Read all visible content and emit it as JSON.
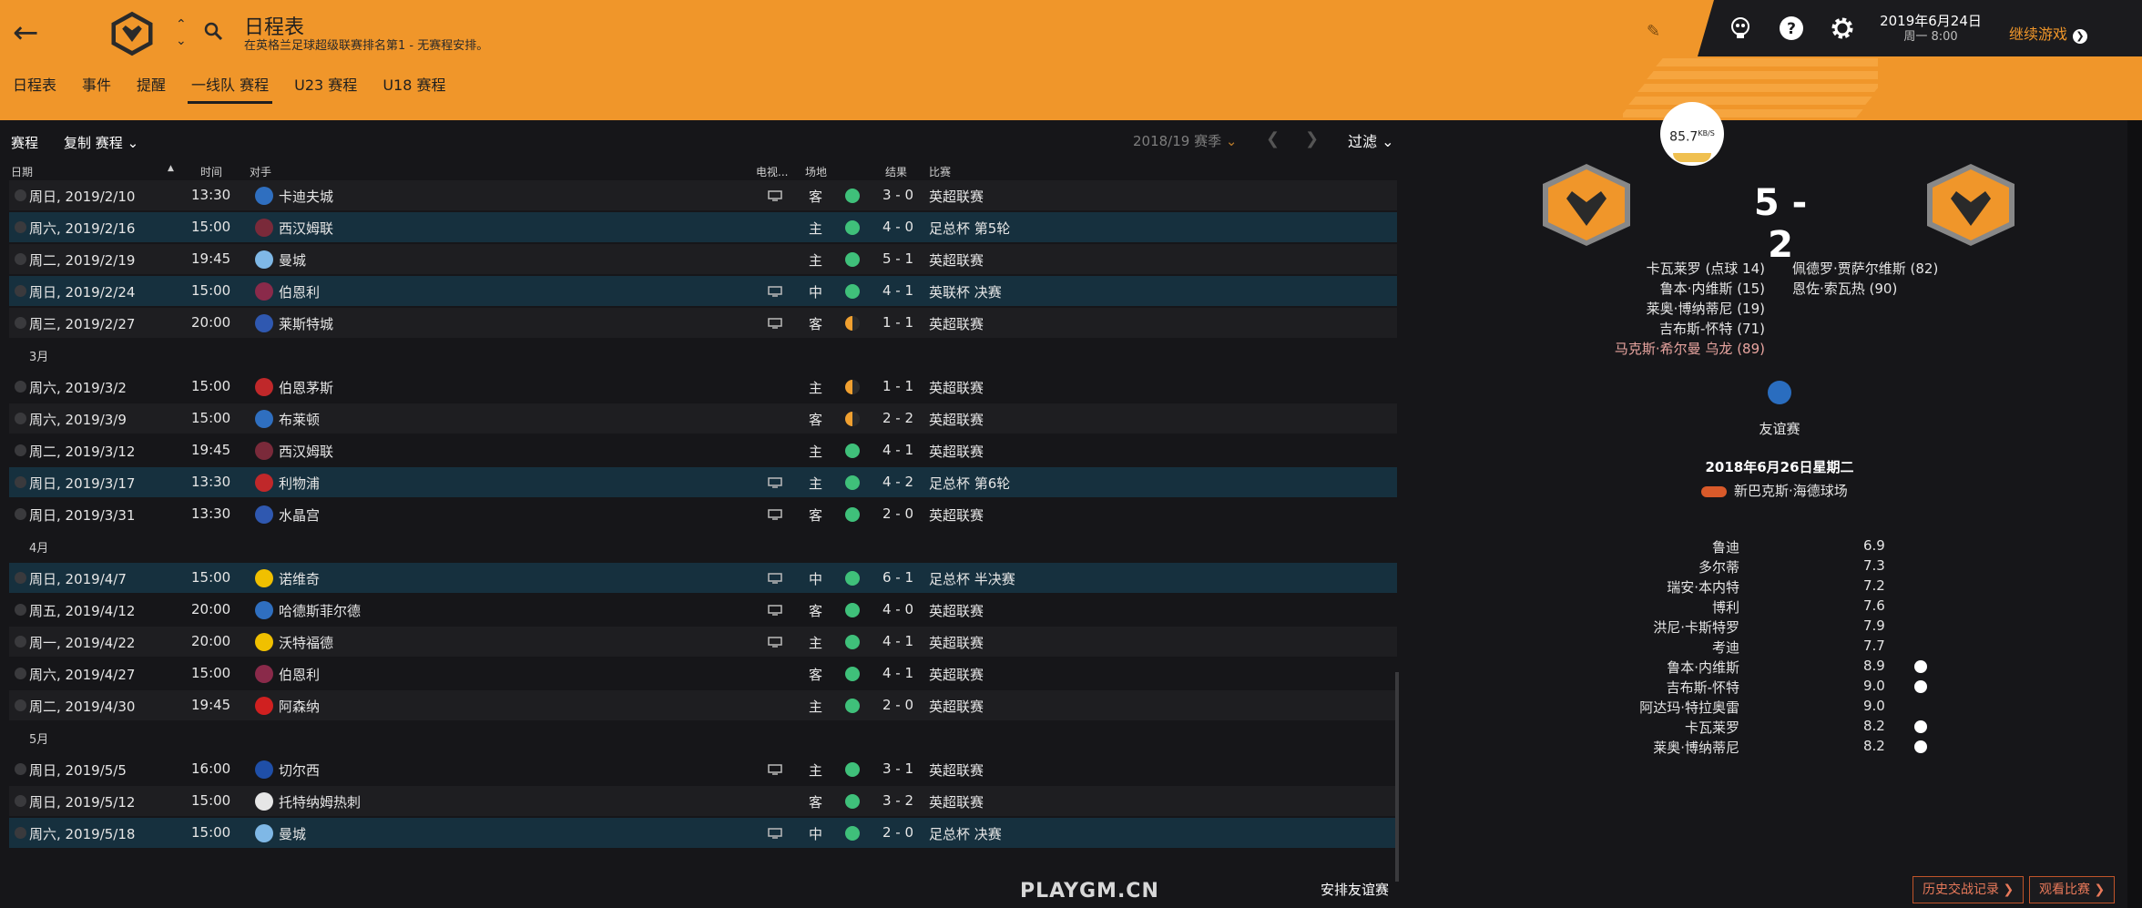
{
  "header": {
    "title": "日程表",
    "subtitle": "在英格兰足球超级联赛排名第1 - 无赛程安排。",
    "tabs": [
      "日程表",
      "事件",
      "提醒",
      "一线队 赛程",
      "U23 赛程",
      "U18 赛程"
    ],
    "active_tab_index": 3
  },
  "top_right": {
    "date": "2019年6月24日",
    "time": "周一 8:00",
    "continue_label": "继续游戏",
    "icons": [
      "fm-icon",
      "help-icon",
      "settings-icon"
    ]
  },
  "panel": {
    "label": "赛程",
    "dropdown": "复制 赛程",
    "season": "2018/19 赛季",
    "filter": "过滤",
    "columns": [
      "日期",
      "时间",
      "对手",
      "电视...",
      "场地",
      "结果",
      "比赛"
    ],
    "arrange_label": "安排友谊赛",
    "watermark": "PLAYGM.CN"
  },
  "fixtures": [
    {
      "date": "周日, 2019/2/10",
      "time": "13:30",
      "opp": "卡迪夫城",
      "tv": true,
      "venue": "客",
      "res": "win",
      "score": "3 - 0",
      "comp": "英超联赛",
      "hl": false,
      "color": "#2f6fc0"
    },
    {
      "date": "周六, 2019/2/16",
      "time": "15:00",
      "opp": "西汉姆联",
      "tv": false,
      "venue": "主",
      "res": "win",
      "score": "4 - 0",
      "comp": "足总杯 第5轮",
      "hl": true,
      "color": "#7a2a3a"
    },
    {
      "date": "周二, 2019/2/19",
      "time": "19:45",
      "opp": "曼城",
      "tv": false,
      "venue": "主",
      "res": "win",
      "score": "5 - 1",
      "comp": "英超联赛",
      "hl": false,
      "color": "#7fb8e6"
    },
    {
      "date": "周日, 2019/2/24",
      "time": "15:00",
      "opp": "伯恩利",
      "tv": true,
      "venue": "中",
      "res": "win",
      "score": "4 - 1",
      "comp": "英联杯 决赛",
      "hl": true,
      "color": "#8a2a4a"
    },
    {
      "date": "周三, 2019/2/27",
      "time": "20:00",
      "opp": "莱斯特城",
      "tv": true,
      "venue": "客",
      "res": "draw",
      "score": "1 - 1",
      "comp": "英超联赛",
      "hl": false,
      "color": "#2f58b0"
    },
    {
      "month": "3月"
    },
    {
      "date": "周六, 2019/3/2",
      "time": "15:00",
      "opp": "伯恩茅斯",
      "tv": false,
      "venue": "主",
      "res": "draw",
      "score": "1 - 1",
      "comp": "英超联赛",
      "hl": false,
      "color": "#c0282a"
    },
    {
      "date": "周六, 2019/3/9",
      "time": "15:00",
      "opp": "布莱顿",
      "tv": false,
      "venue": "客",
      "res": "draw",
      "score": "2 - 2",
      "comp": "英超联赛",
      "hl": false,
      "color": "#2f6fc0"
    },
    {
      "date": "周二, 2019/3/12",
      "time": "19:45",
      "opp": "西汉姆联",
      "tv": false,
      "venue": "主",
      "res": "win",
      "score": "4 - 1",
      "comp": "英超联赛",
      "hl": false,
      "color": "#7a2a3a"
    },
    {
      "date": "周日, 2019/3/17",
      "time": "13:30",
      "opp": "利物浦",
      "tv": true,
      "venue": "主",
      "res": "win",
      "score": "4 - 2",
      "comp": "足总杯 第6轮",
      "hl": true,
      "color": "#c0282a"
    },
    {
      "date": "周日, 2019/3/31",
      "time": "13:30",
      "opp": "水晶宫",
      "tv": true,
      "venue": "客",
      "res": "win",
      "score": "2 - 0",
      "comp": "英超联赛",
      "hl": false,
      "color": "#2f58b0"
    },
    {
      "month": "4月"
    },
    {
      "date": "周日, 2019/4/7",
      "time": "15:00",
      "opp": "诺维奇",
      "tv": true,
      "venue": "中",
      "res": "win",
      "score": "6 - 1",
      "comp": "足总杯 半决赛",
      "hl": true,
      "color": "#f0c000"
    },
    {
      "date": "周五, 2019/4/12",
      "time": "20:00",
      "opp": "哈德斯菲尔德",
      "tv": true,
      "venue": "客",
      "res": "win",
      "score": "4 - 0",
      "comp": "英超联赛",
      "hl": false,
      "color": "#2f6fc0"
    },
    {
      "date": "周一, 2019/4/22",
      "time": "20:00",
      "opp": "沃特福德",
      "tv": true,
      "venue": "主",
      "res": "win",
      "score": "4 - 1",
      "comp": "英超联赛",
      "hl": false,
      "color": "#f0c000"
    },
    {
      "date": "周六, 2019/4/27",
      "time": "15:00",
      "opp": "伯恩利",
      "tv": false,
      "venue": "客",
      "res": "win",
      "score": "4 - 1",
      "comp": "英超联赛",
      "hl": false,
      "color": "#8a2a4a"
    },
    {
      "date": "周二, 2019/4/30",
      "time": "19:45",
      "opp": "阿森纳",
      "tv": false,
      "venue": "主",
      "res": "win",
      "score": "2 - 0",
      "comp": "英超联赛",
      "hl": false,
      "color": "#d02020"
    },
    {
      "month": "5月"
    },
    {
      "date": "周日, 2019/5/5",
      "time": "16:00",
      "opp": "切尔西",
      "tv": true,
      "venue": "主",
      "res": "win",
      "score": "3 - 1",
      "comp": "英超联赛",
      "hl": false,
      "color": "#1f4fa8"
    },
    {
      "date": "周日, 2019/5/12",
      "time": "15:00",
      "opp": "托特纳姆热刺",
      "tv": false,
      "venue": "客",
      "res": "win",
      "score": "3 - 2",
      "comp": "英超联赛",
      "hl": false,
      "color": "#e6e6e6"
    },
    {
      "date": "周六, 2019/5/18",
      "time": "15:00",
      "opp": "曼城",
      "tv": true,
      "venue": "中",
      "res": "win",
      "score": "2 - 0",
      "comp": "足总杯 决赛",
      "hl": true,
      "color": "#7fb8e6"
    }
  ],
  "match": {
    "speed_value": "85.7",
    "speed_unit": "KB/S",
    "score": "5 - 2",
    "home_scorers": [
      "卡瓦莱罗 (点球 14)",
      "鲁本·内维斯 (15)",
      "莱奥·博纳蒂尼 (19)",
      "吉布斯-怀特 (71)"
    ],
    "own_goal": "马克斯·希尔曼 乌龙 (89)",
    "away_scorers": [
      "佩德罗·贾萨尔维斯 (82)",
      "恩佐·索瓦热 (90)"
    ],
    "competition": "友谊赛",
    "date": "2018年6月26日星期二",
    "stadium": "新巴克斯·海德球场",
    "ratings": [
      {
        "name": "鲁迪",
        "value": "6.9",
        "star": false
      },
      {
        "name": "多尔蒂",
        "value": "7.3",
        "star": false
      },
      {
        "name": "瑞安·本内特",
        "value": "7.2",
        "star": false
      },
      {
        "name": "博利",
        "value": "7.6",
        "star": false
      },
      {
        "name": "洪尼·卡斯特罗",
        "value": "7.9",
        "star": false
      },
      {
        "name": "考迪",
        "value": "7.7",
        "star": false
      },
      {
        "name": "鲁本·内维斯",
        "value": "8.9",
        "star": true
      },
      {
        "name": "吉布斯-怀特",
        "value": "9.0",
        "star": true
      },
      {
        "name": "阿达玛·特拉奥雷",
        "value": "9.0",
        "star": false
      },
      {
        "name": "卡瓦莱罗",
        "value": "8.2",
        "star": true
      },
      {
        "name": "莱奥·博纳蒂尼",
        "value": "8.2",
        "star": true
      }
    ],
    "history_btn": "历史交战记录",
    "watch_btn": "观看比赛"
  }
}
